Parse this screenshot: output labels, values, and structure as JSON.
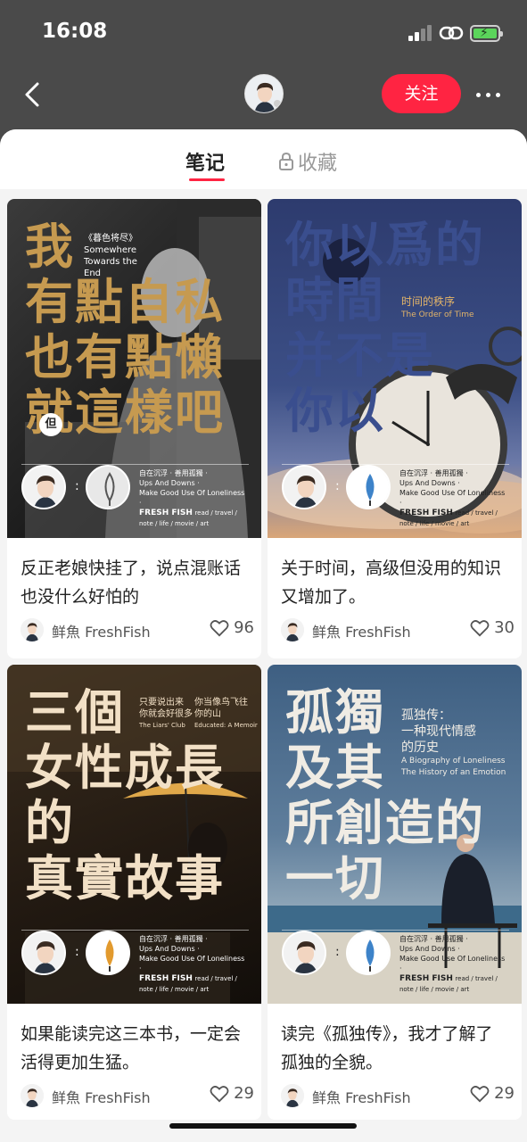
{
  "status": {
    "time": "16:08"
  },
  "nav": {
    "follow_label": "关注"
  },
  "tabs": {
    "notes": "笔记",
    "collect": "收藏"
  },
  "cards": [
    {
      "title": "反正老娘快挂了，说点混账话也没什么好怕的",
      "author": "鲜魚 FreshFish",
      "likes": "96",
      "cover": {
        "big": [
          "我",
          "有點自私",
          "也有點懶",
          "就這樣吧"
        ],
        "book_cn": "《暮色将尽》",
        "book_en": "Somewhere Towards the End",
        "badge": "但",
        "meta1": "自在沉浮 · 善用孤獨 ·",
        "meta2": "Ups And Downs ·",
        "meta3": "Make Good Use Of Loneliness ·",
        "brand": "FRESH FISH",
        "tags": "read / travel / note / life / movie / art"
      }
    },
    {
      "title": "关于时间，高级但没用的知识又增加了。",
      "author": "鲜魚 FreshFish",
      "likes": "30",
      "cover": {
        "big": [
          "你以爲的",
          "時間",
          "并不是",
          "你以"
        ],
        "book_cn": "时间的秩序",
        "book_en": "The Order of Time",
        "meta1": "自在沉浮 · 善用孤獨 ·",
        "meta2": "Ups And Downs ·",
        "meta3": "Make Good Use Of Loneliness ·",
        "brand": "FRESH FISH",
        "tags": "read / travel / note / life / movie / art"
      }
    },
    {
      "title": "如果能读完这三本书，一定会活得更加生猛。",
      "author": "鲜魚 FreshFish",
      "likes": "29",
      "cover": {
        "big": [
          "三個",
          "女性成長",
          "的",
          "真實故事"
        ],
        "book1_cn": "只要说出来",
        "book1_cn2": "你就会好很多",
        "book1_en": "The Liars' Club",
        "book2_cn": "你当像鸟飞往",
        "book2_cn2": "你的山",
        "book2_en": "Educated: A Memoir",
        "meta1": "自在沉浮 · 善用孤獨 ·",
        "meta2": "Ups And Downs ·",
        "meta3": "Make Good Use Of Loneliness ·",
        "brand": "FRESH FISH",
        "tags": "read / travel / note / life / movie / art"
      }
    },
    {
      "title": "读完《孤独传》，我才了解了孤独的全貌。",
      "author": "鲜魚 FreshFish",
      "likes": "29",
      "cover": {
        "big": [
          "孤獨",
          "及其",
          "所創造的",
          "一切"
        ],
        "book_cn": "孤独传：",
        "book_cn2": "一种现代情感",
        "book_cn3": "的历史",
        "book_en": "A Biography of Loneliness",
        "book_en2": "The History of an Emotion",
        "meta1": "自在沉浮 · 善用孤獨 ·",
        "meta2": "Ups And Downs ·",
        "meta3": "Make Good Use Of Loneliness ·",
        "brand": "FRESH FISH",
        "tags": "read / travel / note / life / movie / art"
      }
    }
  ]
}
